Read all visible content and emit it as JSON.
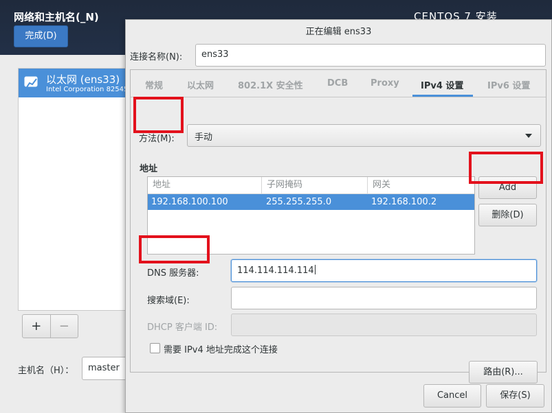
{
  "installer": {
    "title": "网络和主机名(_N)",
    "done_label": "完成(D)",
    "product": "CENTOS 7 安装",
    "interface": {
      "name": "以太网 (ens33)",
      "description": "Intel Corporation 82545"
    },
    "add_label": "+",
    "remove_label": "−",
    "hostname_label": "主机名（H）：",
    "hostname_value": "master"
  },
  "dialog": {
    "title": "正在编辑 ens33",
    "connection_name_label": "连接名称(N):",
    "connection_name_value": "ens33",
    "tabs": [
      {
        "label": "常规"
      },
      {
        "label": "以太网"
      },
      {
        "label": "802.1X 安全性"
      },
      {
        "label": "DCB"
      },
      {
        "label": "Proxy"
      },
      {
        "label": "IPv4 设置",
        "active": true
      },
      {
        "label": "IPv6 设置"
      }
    ],
    "method_label": "方法(M):",
    "method_value": "手动",
    "address_heading": "地址",
    "address_table": {
      "columns": [
        "地址",
        "子网掩码",
        "网关"
      ],
      "rows": [
        {
          "address": "192.168.100.100",
          "netmask": "255.255.255.0",
          "gateway": "192.168.100.2",
          "selected": true
        }
      ]
    },
    "add_label": "Add",
    "delete_label": "删除(D)",
    "dns_label": "DNS 服务器:",
    "dns_value": "114.114.114.114",
    "search_label": "搜索域(E):",
    "search_value": "",
    "dhcp_label": "DHCP 客户端 ID:",
    "dhcp_value": "",
    "require_label": "需要 IPv4 地址完成这个连接",
    "require_checked": false,
    "routes_label": "路由(R)...",
    "cancel_label": "Cancel",
    "save_label": "保存(S)"
  },
  "colors": {
    "accent": "#4a90d9",
    "highlight": "#e3111c",
    "header_bg": "#223047"
  }
}
